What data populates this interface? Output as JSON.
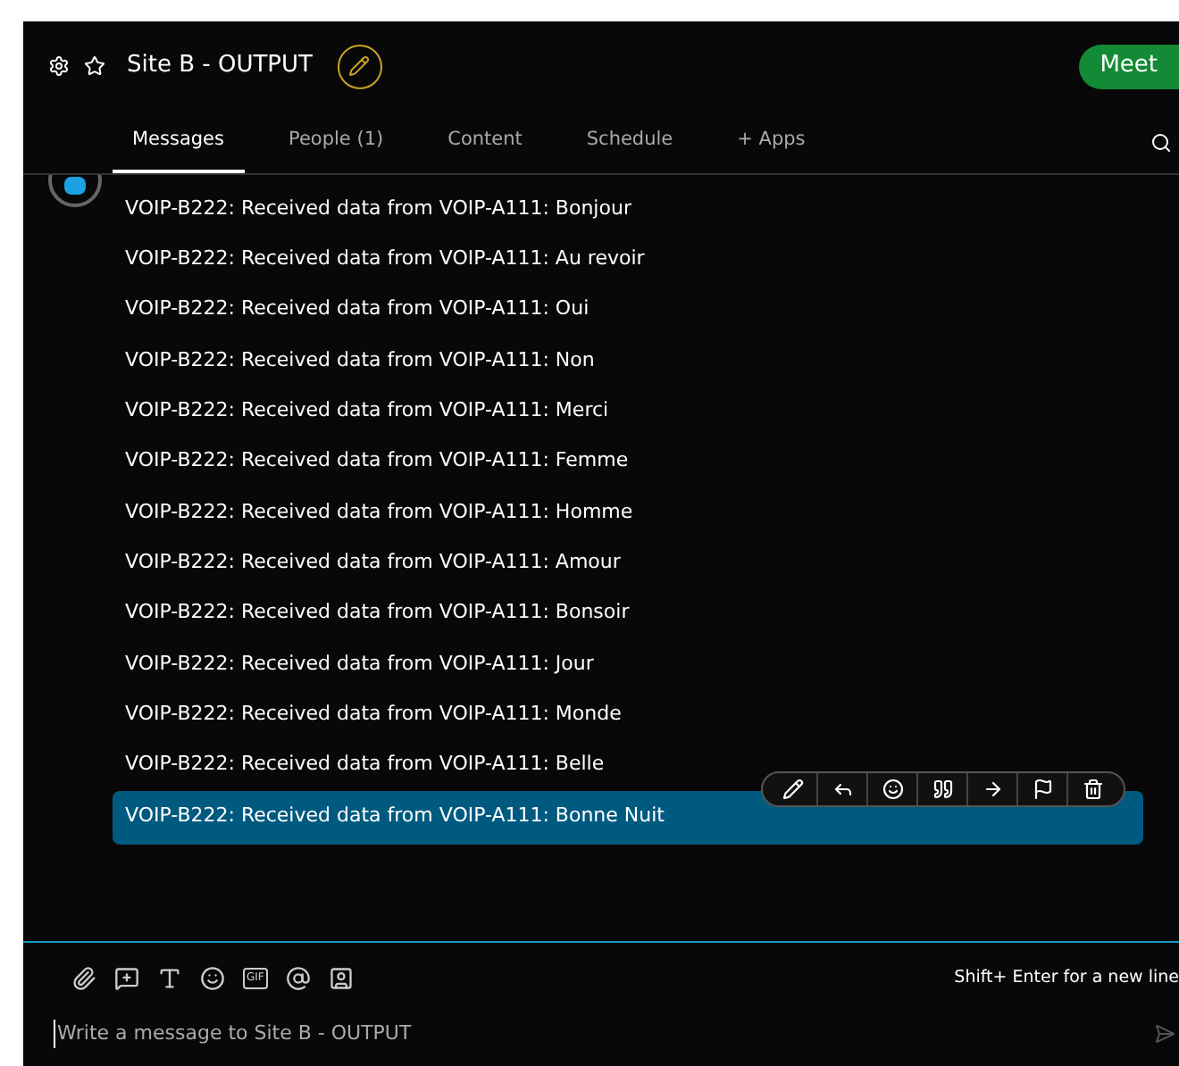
{
  "header": {
    "title": "Site B - OUTPUT",
    "meet_button": "Meet"
  },
  "tabs": [
    {
      "label": "Messages",
      "selected": true
    },
    {
      "label": "People (1)",
      "selected": false
    },
    {
      "label": "Content",
      "selected": false
    },
    {
      "label": "Schedule",
      "selected": false
    },
    {
      "label": "+ Apps",
      "selected": false
    }
  ],
  "messages": [
    {
      "text": "VOIP-B222: Received data from VOIP-A111: Bonjour",
      "selected": false
    },
    {
      "text": "VOIP-B222: Received data from VOIP-A111: Au revoir",
      "selected": false
    },
    {
      "text": "VOIP-B222: Received data from VOIP-A111: Oui",
      "selected": false
    },
    {
      "text": "VOIP-B222: Received data from VOIP-A111: Non",
      "selected": false
    },
    {
      "text": "VOIP-B222: Received data from VOIP-A111: Merci",
      "selected": false
    },
    {
      "text": "VOIP-B222: Received data from VOIP-A111: Femme",
      "selected": false
    },
    {
      "text": "VOIP-B222: Received data from VOIP-A111: Homme",
      "selected": false
    },
    {
      "text": "VOIP-B222: Received data from VOIP-A111: Amour",
      "selected": false
    },
    {
      "text": "VOIP-B222: Received data from VOIP-A111: Bonsoir",
      "selected": false
    },
    {
      "text": "VOIP-B222: Received data from VOIP-A111: Jour",
      "selected": false
    },
    {
      "text": "VOIP-B222: Received data from VOIP-A111: Monde",
      "selected": false
    },
    {
      "text": "VOIP-B222: Received data from VOIP-A111: Belle",
      "selected": false
    },
    {
      "text": "VOIP-B222: Received data from VOIP-A111: Bonne Nuit",
      "selected": true
    }
  ],
  "composer": {
    "gif_label": "GIF",
    "hint": "Shift+ Enter for a new line",
    "placeholder": "Write a message to Site B - OUTPUT"
  }
}
